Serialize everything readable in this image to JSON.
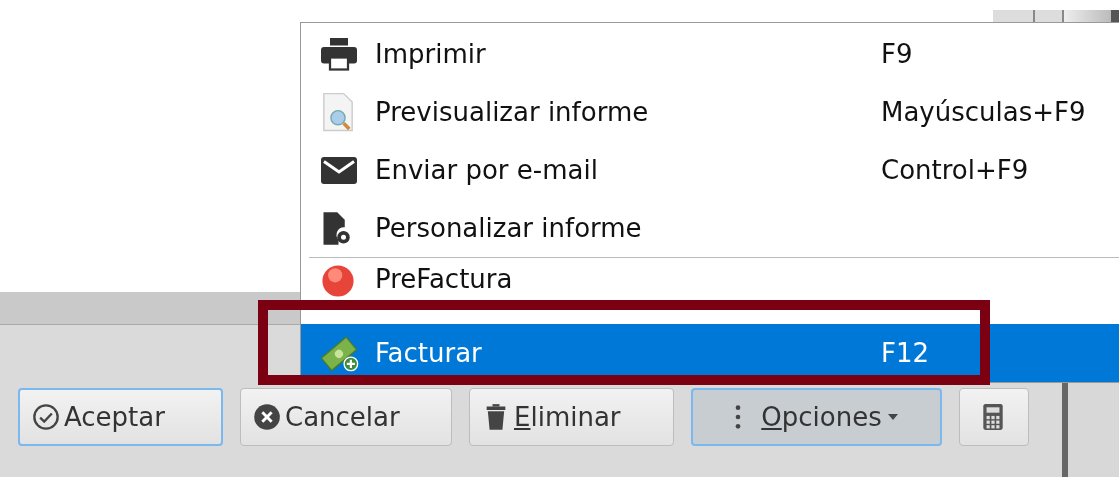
{
  "menu": {
    "items": [
      {
        "label": "Imprimir",
        "shortcut": "F9",
        "selected": false
      },
      {
        "label": "Previsualizar informe",
        "shortcut": "Mayúsculas+F9",
        "selected": false
      },
      {
        "label": "Enviar por e-mail",
        "shortcut": "Control+F9",
        "selected": false
      },
      {
        "label": "Personalizar informe",
        "selected": false,
        "separator_after": true
      },
      {
        "label": "PreFactura",
        "selected": false
      },
      {
        "label": "Facturar",
        "shortcut": "F12",
        "selected": true
      }
    ]
  },
  "buttons": [
    {
      "label": "Aceptar",
      "focused": false,
      "default": true
    },
    {
      "label": "Cancelar",
      "focused": false
    },
    {
      "label": "Eliminar",
      "focused": false,
      "underline_first": true
    },
    {
      "label": "Opciones",
      "focused": true,
      "underline_first": true,
      "dropdown": true
    },
    {
      "focused": false
    }
  ]
}
